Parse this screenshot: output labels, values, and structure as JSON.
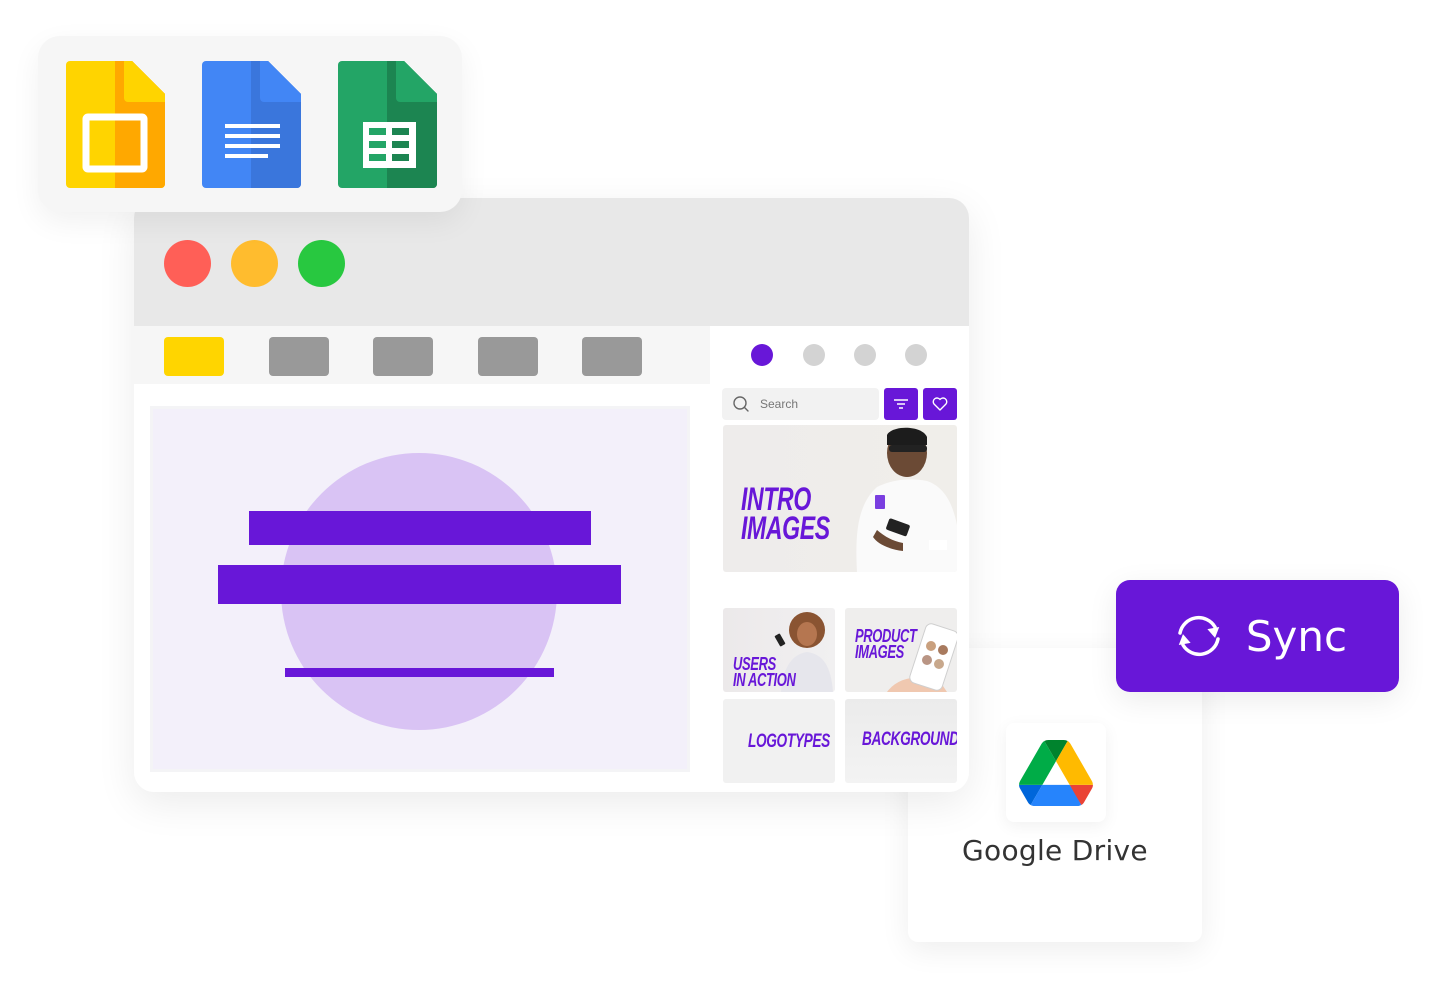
{
  "colors": {
    "accent": "#6817d8",
    "accent_light": "#d9c3f4",
    "slide_bg": "#f3f0fa",
    "traffic_red": "#ff5f57",
    "traffic_yellow": "#ffbc2e",
    "traffic_green": "#28c840",
    "tool_active": "#ffd500",
    "tool_inactive": "#999999"
  },
  "apps": [
    {
      "name": "Google Slides",
      "icon": "google-slides-icon"
    },
    {
      "name": "Google Docs",
      "icon": "google-docs-icon"
    },
    {
      "name": "Google Sheets",
      "icon": "google-sheets-icon"
    }
  ],
  "window": {
    "controls": [
      "close",
      "minimize",
      "maximize"
    ],
    "toolbar": {
      "tool_count": 5,
      "active_index": 0
    },
    "panel": {
      "pager": {
        "count": 4,
        "active_index": 0
      },
      "search": {
        "placeholder": "Search",
        "value": ""
      },
      "filter_icon": "filter-icon",
      "favorite_icon": "heart-icon",
      "tiles": [
        {
          "label_line1": "Intro",
          "label_line2": "Images"
        },
        {
          "label_line1": "Users",
          "label_line2": "In Action"
        },
        {
          "label_line1": "Product",
          "label_line2": "Images"
        },
        {
          "label_line1": "Logotypes",
          "label_line2": ""
        },
        {
          "label_line1": "Backgrounds",
          "label_line2": ""
        }
      ]
    }
  },
  "sync": {
    "label": "Sync",
    "icon": "sync-icon"
  },
  "drive": {
    "label": "Google Drive",
    "icon": "google-drive-icon"
  }
}
